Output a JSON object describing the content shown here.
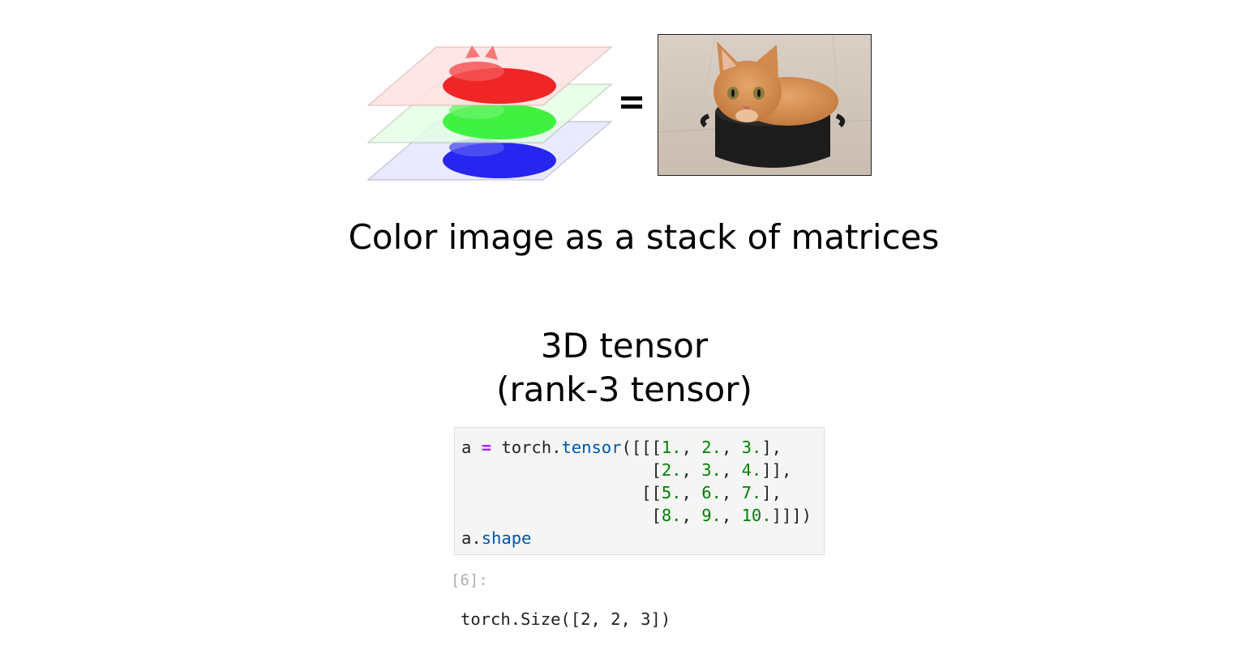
{
  "illustration": {
    "equals": "=",
    "channel_colors": {
      "red": "#ee1111",
      "green": "#22ee22",
      "blue": "#1111ee"
    }
  },
  "captions": {
    "main": "Color image as a stack of matrices",
    "tensor_title_line1": "3D tensor",
    "tensor_title_line2": "(rank-3 tensor)"
  },
  "notebook": {
    "code_lines": [
      "a = torch.tensor([[[1., 2., 3.],",
      "                   [2., 3., 4.]],",
      "                  [[5., 6., 7.],",
      "                   [8., 9., 10.]]])",
      "a.shape"
    ],
    "execution_count": "[6]:",
    "output": "torch.Size([2, 2, 3])"
  }
}
